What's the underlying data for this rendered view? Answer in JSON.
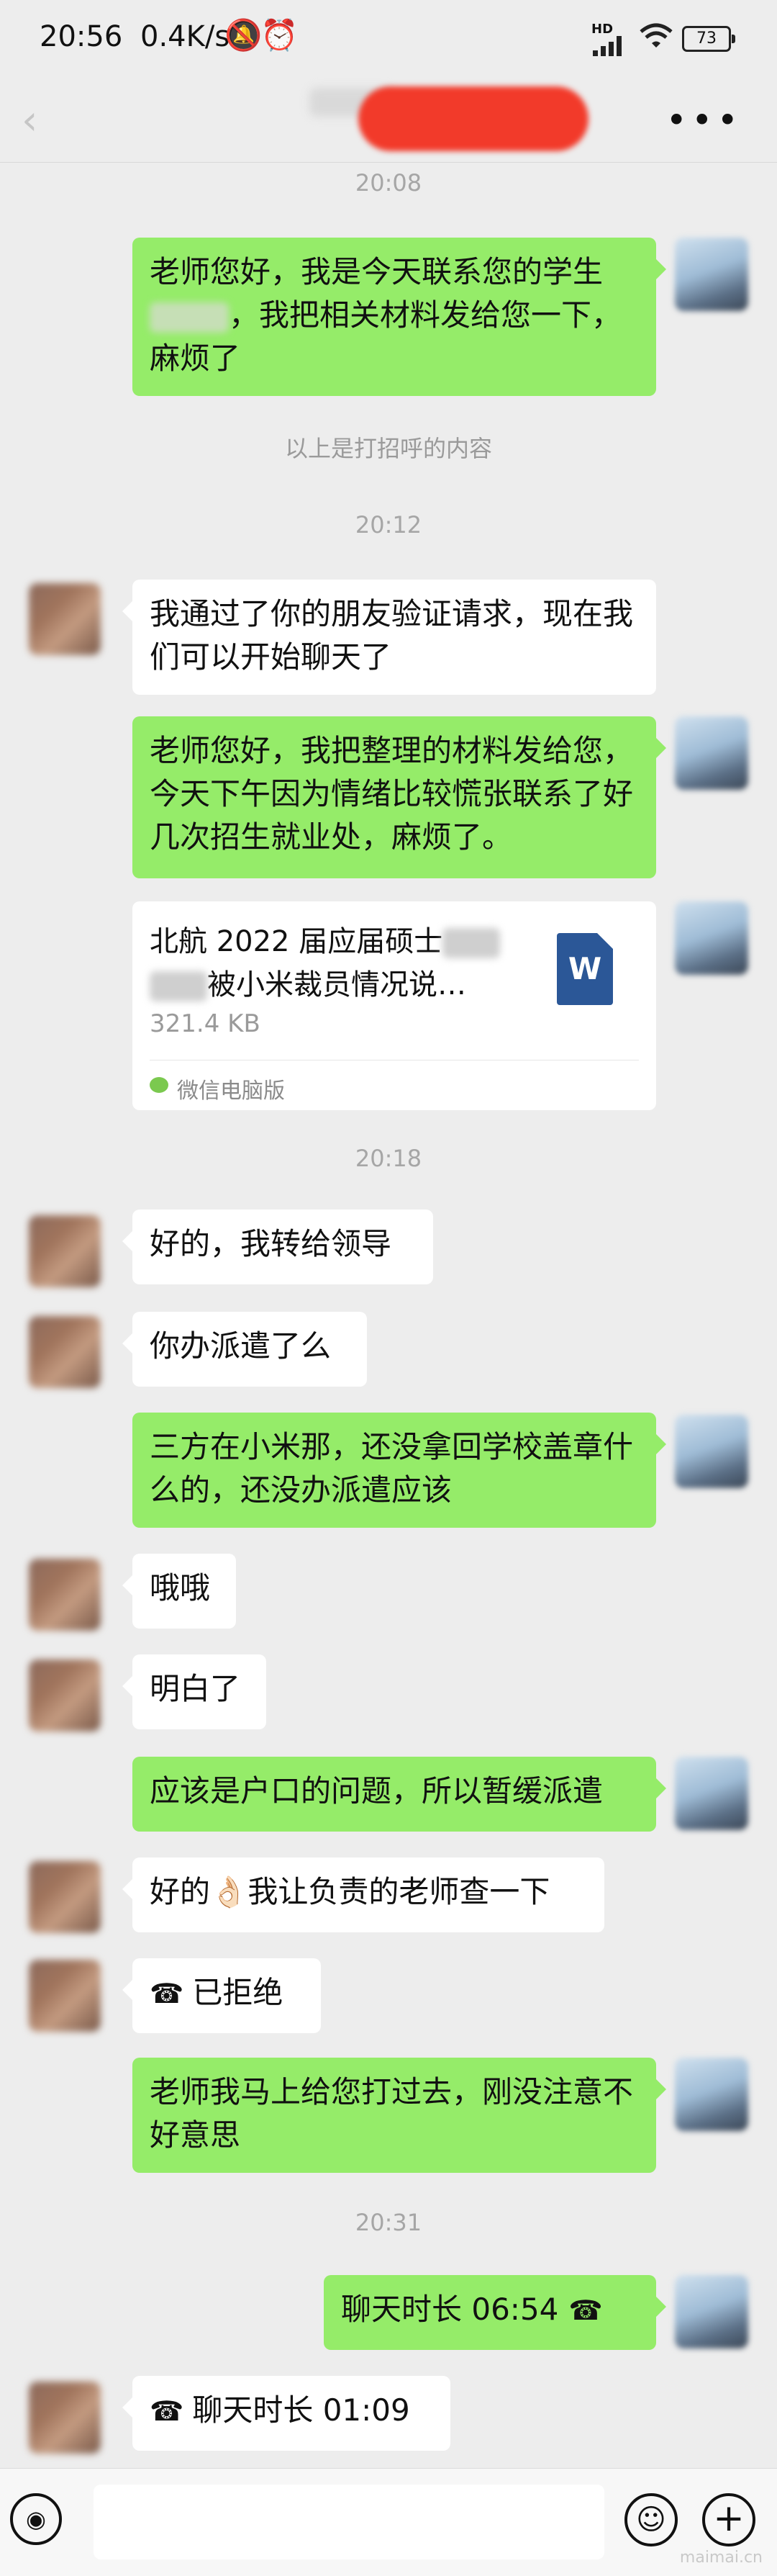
{
  "status_bar": {
    "time": "20:56",
    "net_speed": "0.4K/s",
    "hd_label": "HD",
    "battery": "73"
  },
  "header": {
    "more_label": "•••"
  },
  "timestamps": {
    "t1": "20:08",
    "t2": "20:12",
    "t3": "20:18",
    "t4": "20:31"
  },
  "system_note": "以上是打招呼的内容",
  "messages": {
    "m1_a": "老师您好，我是今天联系您的学生",
    "m1_b": "，我把相关材料发给您一下，麻烦了",
    "m2": "我通过了你的朋友验证请求，现在我们可以开始聊天了",
    "m3": "老师您好，我把整理的材料发给您，今天下午因为情绪比较慌张联系了好几次招生就业处，麻烦了。",
    "m4": "好的，我转给领导",
    "m5": "你办派遣了么",
    "m6": "三方在小米那，还没拿回学校盖章什么的，还没办派遣应该",
    "m7": "哦哦",
    "m8": "明白了",
    "m9": "应该是户口的问题，所以暂缓派遣",
    "m10_a": "好的",
    "m10_emoji": "👌🏻",
    "m10_b": "我让负责的老师查一下",
    "m11": "已拒绝",
    "m12": "老师我马上给您打过去，刚没注意不好意思",
    "m13": "聊天时长 06:54",
    "m14": "聊天时长 01:09"
  },
  "file": {
    "name_a": "北航 2022 届应届硕士",
    "name_b": "被小米裁员情况说…",
    "size": "321.4 KB",
    "source": "微信电脑版",
    "icon_letter": "W"
  },
  "icons": {
    "back": "back-arrow-icon",
    "call": "phone-handset-icon",
    "voice": "voice-input-icon",
    "emoji": "emoji-icon",
    "plus": "plus-icon"
  },
  "watermark": "maimai.cn",
  "colors": {
    "bubble_self": "#95ec69",
    "bubble_other": "#ffffff",
    "background": "#ededed",
    "redaction": "#f23a2a"
  }
}
